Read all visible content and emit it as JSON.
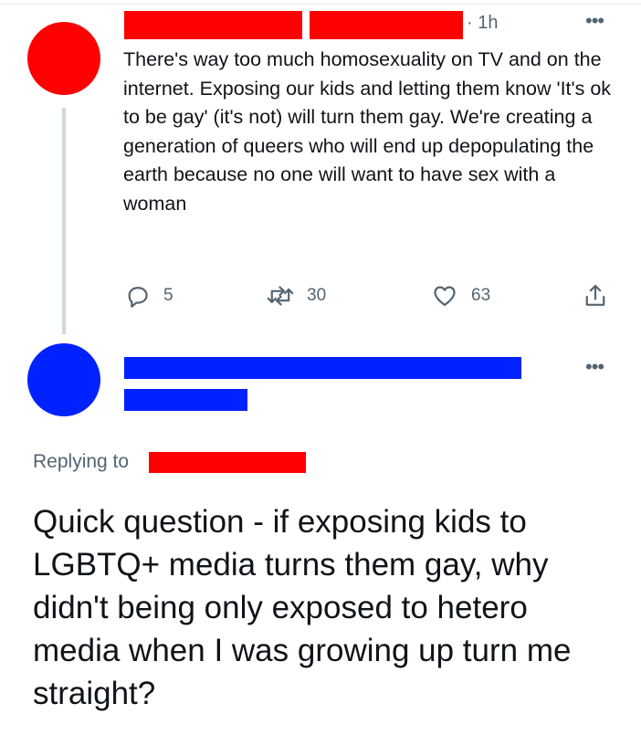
{
  "colors": {
    "redaction_red": "#ff0000",
    "redaction_blue": "#0022ff",
    "secondary_text": "#536471",
    "thread_line": "#cfd9de"
  },
  "original_tweet": {
    "timestamp": "· 1h",
    "more_icon": "more-horizontal-icon",
    "text": "There's way too much homosexuality on TV and on the internet. Exposing our kids and letting them know 'It's ok to be gay' (it's not) will turn them gay. We're creating a generation of queers who will end up depopulating the earth because no one will want to have sex with a woman",
    "actions": {
      "reply_count": "5",
      "retweet_count": "30",
      "like_count": "63"
    }
  },
  "reply_tweet": {
    "more_icon": "more-horizontal-icon",
    "replying_to_label": "Replying to",
    "text": "Quick question - if exposing kids to LGBTQ+ media turns them gay, why didn't being only exposed to hetero media when I was growing up turn me straight?"
  }
}
